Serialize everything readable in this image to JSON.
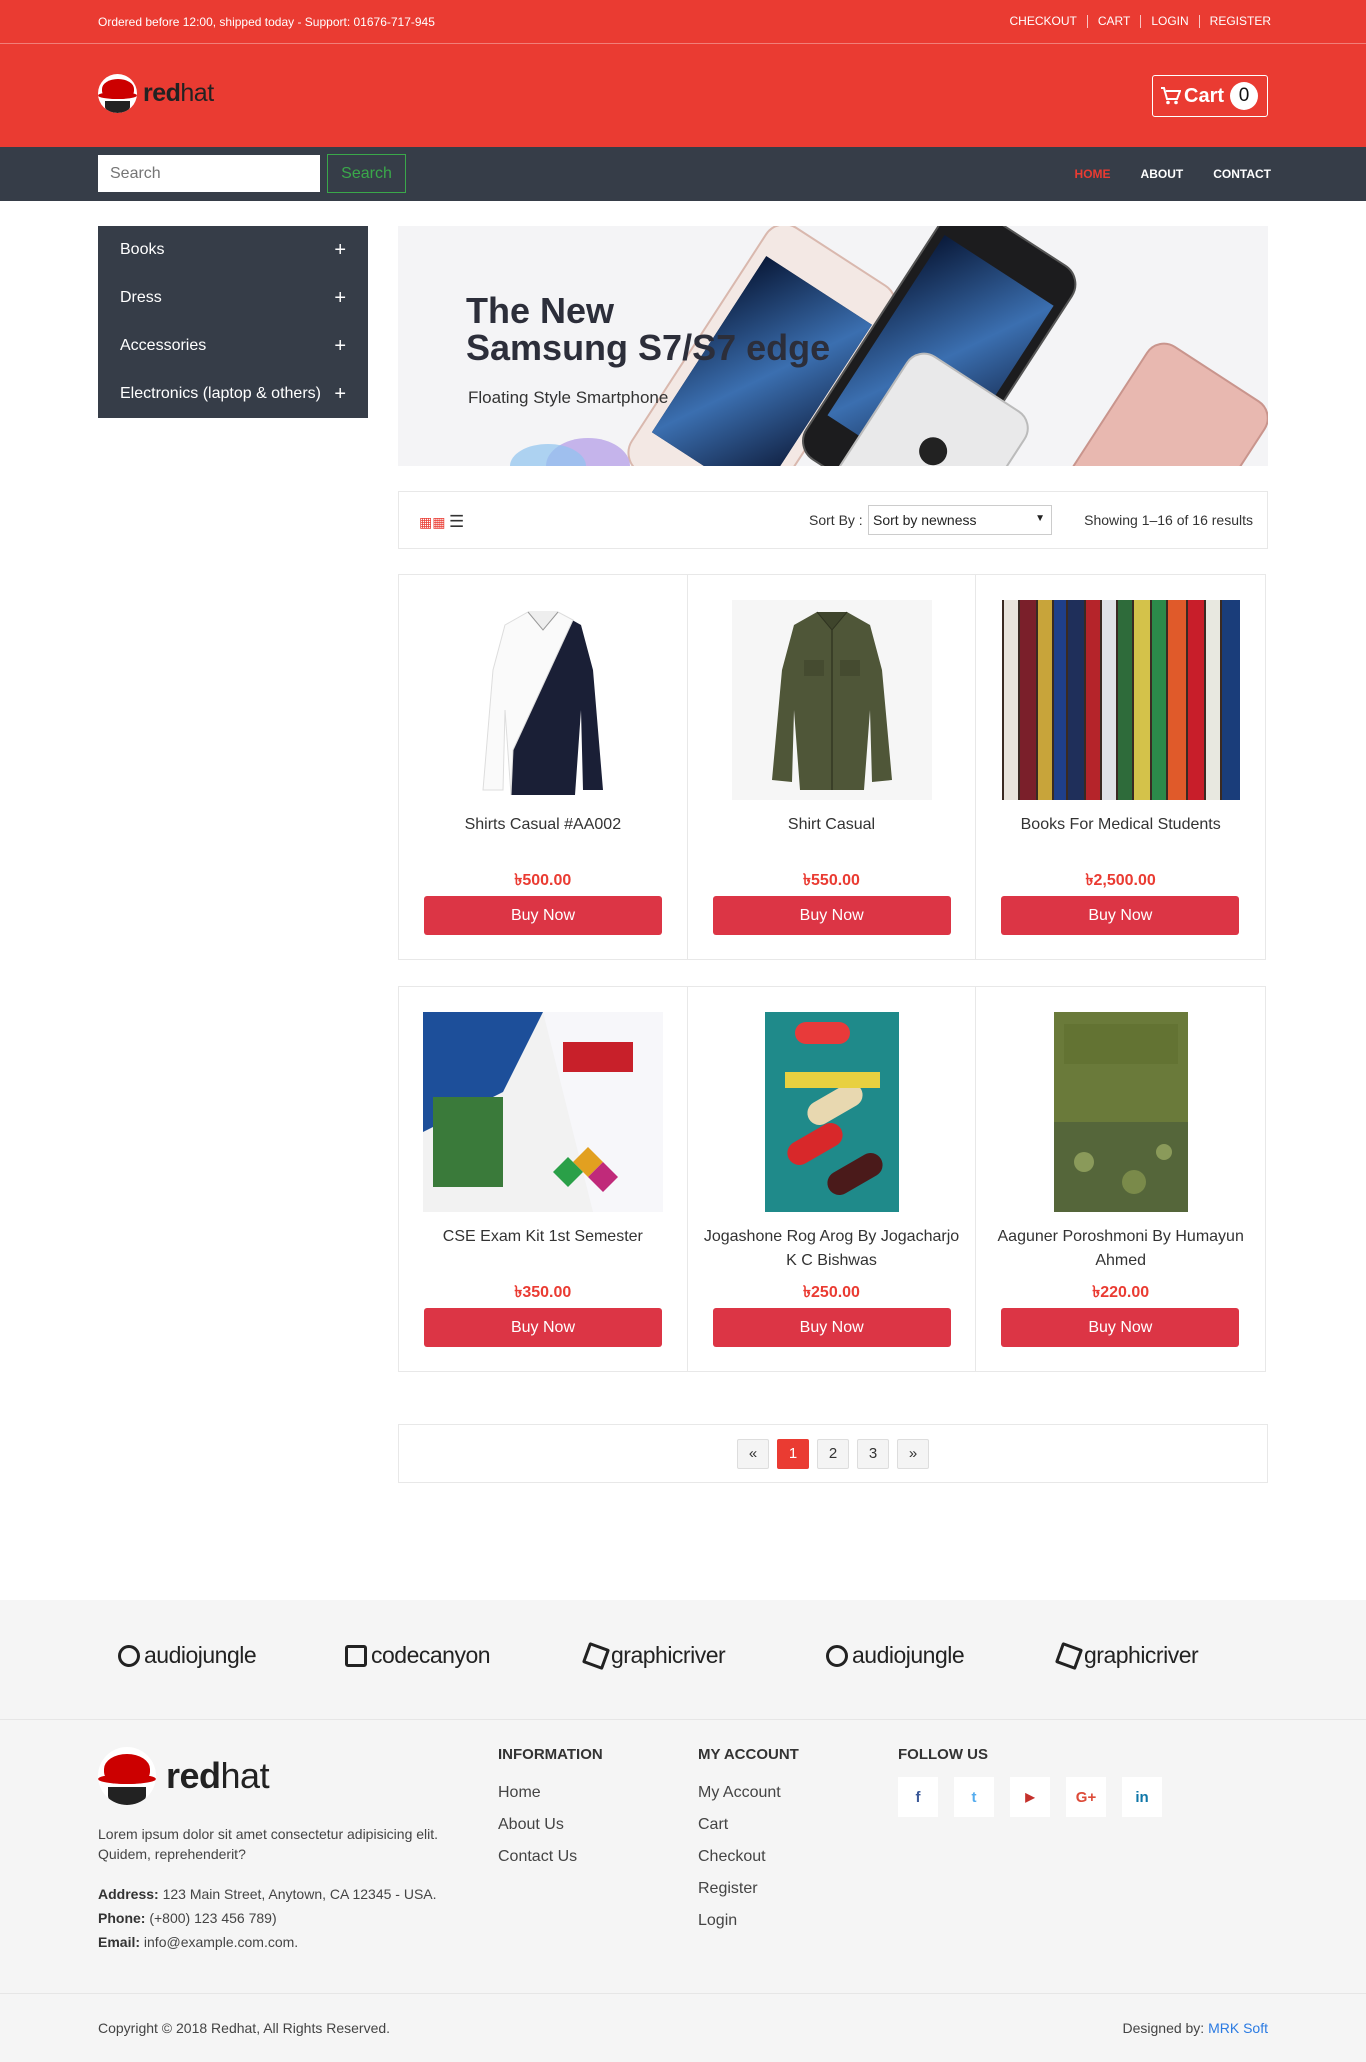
{
  "topbar": {
    "notice": "Ordered before 12:00, shipped today - Support: 01676-717-945",
    "links": [
      "CHECKOUT",
      "CART",
      "LOGIN",
      "REGISTER"
    ]
  },
  "header": {
    "logo_bold": "red",
    "logo_light": "hat",
    "cart_label": "Cart",
    "cart_count": "0"
  },
  "nav": {
    "search_placeholder": "Search",
    "search_button": "Search",
    "menu": [
      "HOME",
      "ABOUT",
      "CONTACT"
    ],
    "active": "HOME"
  },
  "sidebar": {
    "categories": [
      "Books",
      "Dress",
      "Accessories",
      "Electronics (laptop & others)"
    ],
    "expand_symbol": "+"
  },
  "banner": {
    "title_line1": "The New",
    "title_line2": "Samsung S7/S7 edge",
    "subtitle": "Floating Style Smartphone"
  },
  "sortbar": {
    "label": "Sort By :",
    "selected": "Sort by newness",
    "results": "Showing 1–16 of 16 results"
  },
  "products": [
    {
      "name": "Shirts Casual #AA002",
      "price": "৳500.00",
      "button": "Buy Now"
    },
    {
      "name": "Shirt Casual",
      "price": "৳550.00",
      "button": "Buy Now"
    },
    {
      "name": "Books For Medical Students",
      "price": "৳2,500.00",
      "button": "Buy Now"
    },
    {
      "name": "CSE Exam Kit 1st Semester",
      "price": "৳350.00",
      "button": "Buy Now"
    },
    {
      "name": "Jogashone Rog Arog By Jogacharjo K C Bishwas",
      "price": "৳250.00",
      "button": "Buy Now"
    },
    {
      "name": "Aaguner Poroshmoni By Humayun Ahmed",
      "price": "৳220.00",
      "button": "Buy Now"
    }
  ],
  "pagination": {
    "prev": "«",
    "pages": [
      "1",
      "2",
      "3"
    ],
    "current": "1",
    "next": "»"
  },
  "brands": [
    "audiojungle",
    "codecanyon",
    "graphicriver",
    "audiojungle",
    "graphicriver"
  ],
  "footer": {
    "logo_bold": "red",
    "logo_light": "hat",
    "description": "Lorem ipsum dolor sit amet consectetur adipisicing elit. Quidem, reprehenderit?",
    "address_label": "Address:",
    "address": "123 Main Street, Anytown, CA 12345 - USA.",
    "phone_label": "Phone:",
    "phone": "(+800) 123 456 789)",
    "email_label": "Email:",
    "email": "info@example.com.com.",
    "information": {
      "title": "INFORMATION",
      "links": [
        "Home",
        "About Us",
        "Contact Us"
      ]
    },
    "account": {
      "title": "MY ACCOUNT",
      "links": [
        "My Account",
        "Cart",
        "Checkout",
        "Register",
        "Login"
      ]
    },
    "follow": {
      "title": "FOLLOW US",
      "icons": [
        "facebook-icon",
        "twitter-icon",
        "youtube-icon",
        "google-plus-icon",
        "linkedin-icon"
      ],
      "glyphs": [
        "f",
        "t",
        "▶",
        "G+",
        "in"
      ]
    }
  },
  "copyright": {
    "text": "Copyright © 2018 Redhat, All Rights Reserved.",
    "designed_label": "Designed by:",
    "designer": "MRK Soft"
  },
  "colors": {
    "brand_red": "#ea3b32",
    "nav_dark": "#363d48",
    "buy_button": "#dc3545",
    "search_green": "#3aa84a",
    "link_blue": "#2a7ae2"
  }
}
